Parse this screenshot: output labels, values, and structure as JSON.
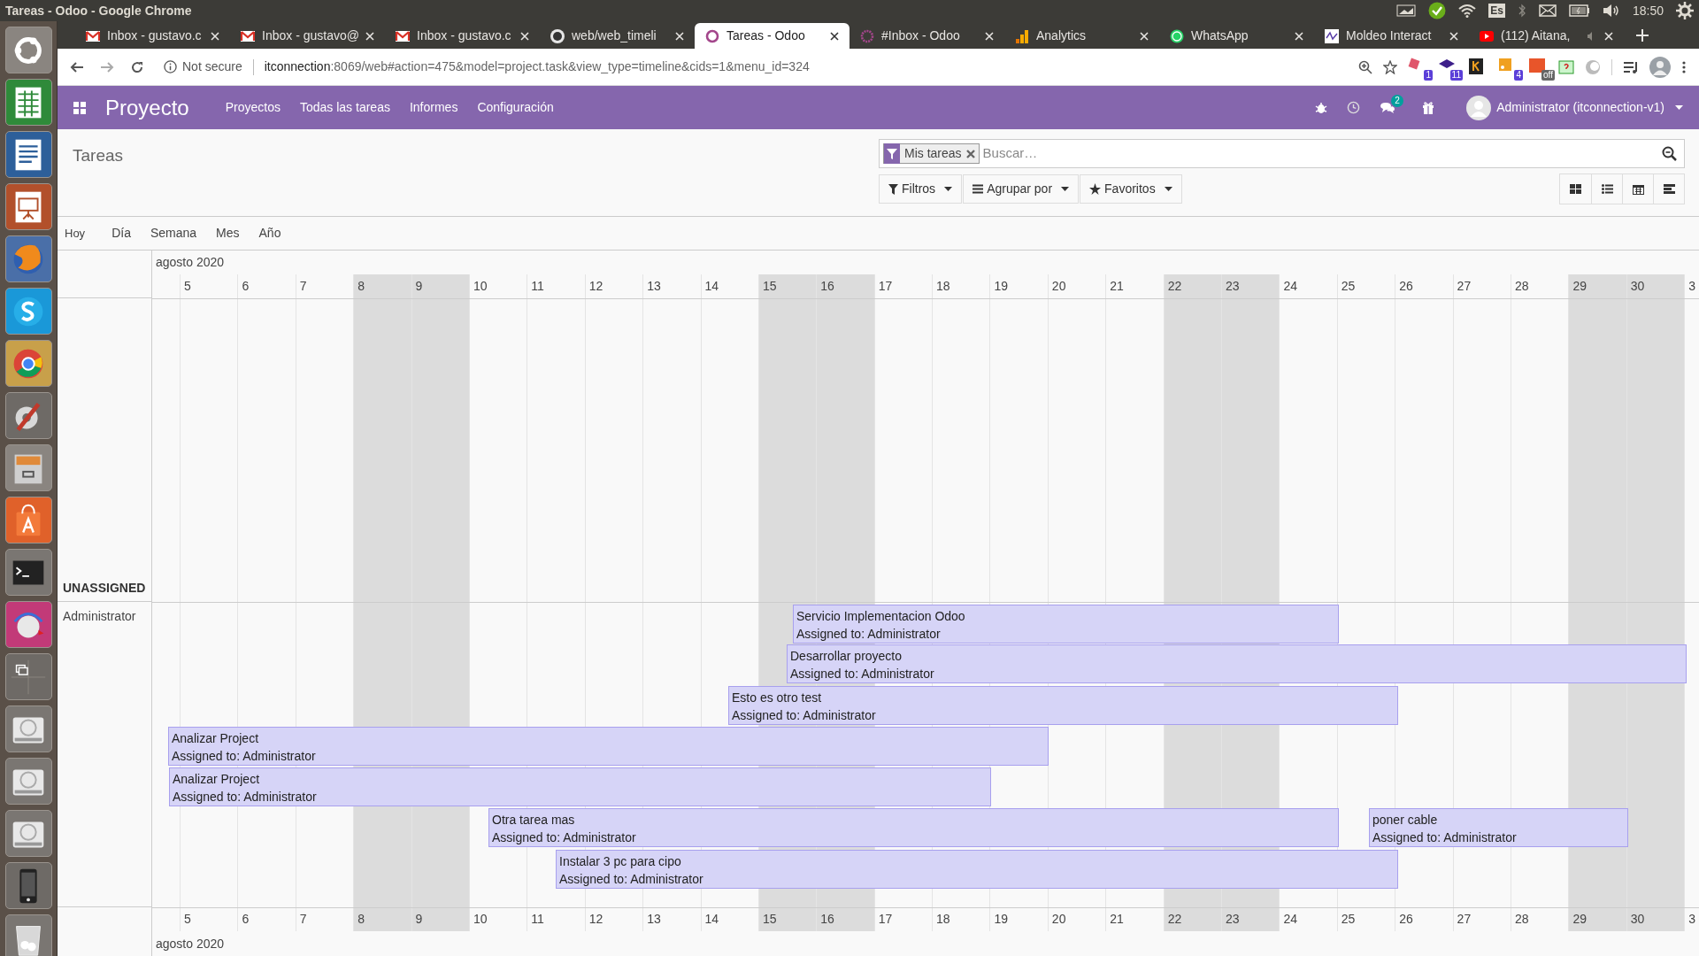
{
  "top_panel": {
    "title": "Tareas - Odoo - Google Chrome",
    "keyboard": "Es",
    "clock": "18:50"
  },
  "tabs": [
    {
      "title": "Inbox - gustavo.c",
      "kind": "gmail",
      "selected": false,
      "audio": false
    },
    {
      "title": "Inbox - gustavo@",
      "kind": "gmail",
      "selected": false,
      "audio": false
    },
    {
      "title": "Inbox - gustavo.c",
      "kind": "gmail",
      "selected": false,
      "audio": false
    },
    {
      "title": "web/web_timeli",
      "kind": "github",
      "selected": false,
      "audio": false
    },
    {
      "title": "Tareas - Odoo",
      "kind": "odoo",
      "selected": true,
      "audio": false
    },
    {
      "title": "#Inbox - Odoo",
      "kind": "odoo-inbox",
      "selected": false,
      "audio": false
    },
    {
      "title": "Analytics",
      "kind": "analytics",
      "selected": false,
      "audio": false
    },
    {
      "title": "WhatsApp",
      "kind": "whatsapp",
      "selected": false,
      "audio": false
    },
    {
      "title": "Moldeo Interact",
      "kind": "moldeo",
      "selected": false,
      "audio": false
    },
    {
      "title": "(112) Aitana,",
      "kind": "youtube",
      "selected": false,
      "audio": true
    }
  ],
  "address_bar": {
    "security": "Not secure",
    "host": "itconnection",
    "path": ":8069/web#action=475&model=project.task&view_type=timeline&cids=1&menu_id=324"
  },
  "extension_badges": [
    "1",
    "11",
    "4",
    "off"
  ],
  "navbar": {
    "app": "Proyecto",
    "menus": [
      "Proyectos",
      "Todas las tareas",
      "Informes",
      "Configuración"
    ],
    "messages_badge": "2",
    "user": "Administrator (itconnection-v1)"
  },
  "control_panel": {
    "breadcrumb": "Tareas",
    "facet": "Mis tareas",
    "search": {
      "placeholder": "Buscar…"
    },
    "buttons": [
      "Filtros",
      "Agrupar por",
      "Favoritos"
    ]
  },
  "scales": [
    "Hoy",
    "Día",
    "Semana",
    "Mes",
    "Año"
  ],
  "timeline": {
    "month": "agosto 2020",
    "days": [
      {
        "label": "5",
        "weekend": false
      },
      {
        "label": "6",
        "weekend": false
      },
      {
        "label": "7",
        "weekend": false
      },
      {
        "label": "8",
        "weekend": true
      },
      {
        "label": "9",
        "weekend": true
      },
      {
        "label": "10",
        "weekend": false
      },
      {
        "label": "11",
        "weekend": false
      },
      {
        "label": "12",
        "weekend": false
      },
      {
        "label": "13",
        "weekend": false
      },
      {
        "label": "14",
        "weekend": false
      },
      {
        "label": "15",
        "weekend": true
      },
      {
        "label": "16",
        "weekend": true
      },
      {
        "label": "17",
        "weekend": false
      },
      {
        "label": "18",
        "weekend": false
      },
      {
        "label": "19",
        "weekend": false
      },
      {
        "label": "20",
        "weekend": false
      },
      {
        "label": "21",
        "weekend": false
      },
      {
        "label": "22",
        "weekend": true
      },
      {
        "label": "23",
        "weekend": true
      },
      {
        "label": "24",
        "weekend": false
      },
      {
        "label": "25",
        "weekend": false
      },
      {
        "label": "26",
        "weekend": false
      },
      {
        "label": "27",
        "weekend": false
      },
      {
        "label": "28",
        "weekend": false
      },
      {
        "label": "29",
        "weekend": true
      },
      {
        "label": "30",
        "weekend": true
      },
      {
        "label": "3",
        "weekend": false
      }
    ],
    "bottom_days": [
      "5",
      "6",
      "7",
      "8",
      "9",
      "10",
      "11",
      "12",
      "13",
      "14",
      "15",
      "16",
      "17",
      "18",
      "19",
      "20",
      "21",
      "22",
      "23",
      "24",
      "25",
      "26",
      "27",
      "28",
      "29",
      "30",
      "3"
    ],
    "bottom_month": "agosto 2020",
    "groups": [
      {
        "name": "UNASSIGNED",
        "kind": "unassigned"
      },
      {
        "name": "Administrator",
        "kind": "user",
        "items": [
          {
            "title": "Servicio Implementacion Odoo",
            "assignee": "Assigned to: Administrator"
          },
          {
            "title": "Desarrollar proyecto",
            "assignee": "Assigned to: Administrator"
          },
          {
            "title": "Esto es otro test",
            "assignee": "Assigned to: Administrator"
          },
          {
            "title": "Analizar Project",
            "assignee": "Assigned to: Administrator"
          },
          {
            "title": "Analizar Project",
            "assignee": "Assigned to: Administrator"
          },
          {
            "title": "Otra tarea mas",
            "assignee": "Assigned to: Administrator"
          },
          {
            "title": "poner cable",
            "assignee": "Assigned to: Administrator"
          },
          {
            "title": "Instalar 3 pc para cipo",
            "assignee": "Assigned to: Administrator"
          }
        ]
      }
    ]
  }
}
